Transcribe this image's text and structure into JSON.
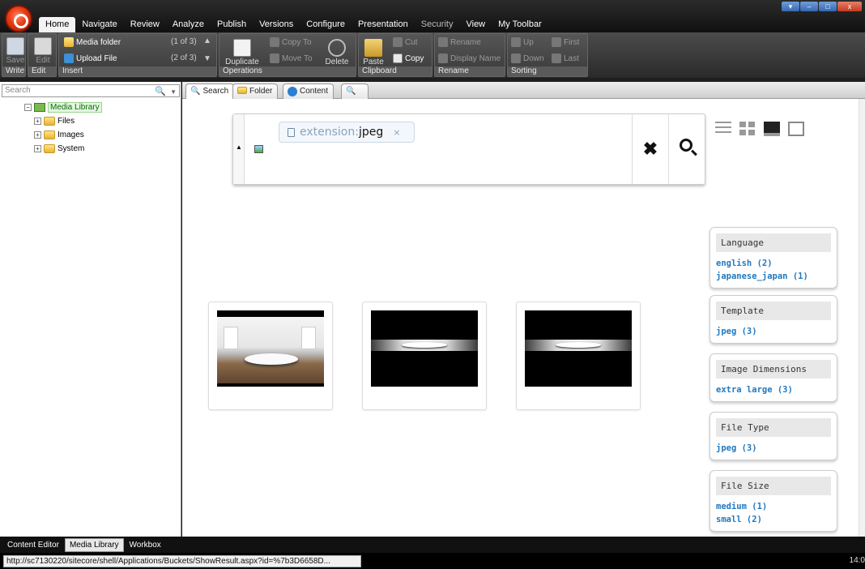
{
  "menu": {
    "items": [
      "Home",
      "Navigate",
      "Review",
      "Analyze",
      "Publish",
      "Versions",
      "Configure",
      "Presentation",
      "Security",
      "View",
      "My Toolbar"
    ]
  },
  "ribbon": {
    "write": {
      "group": "Write",
      "save": "Save"
    },
    "edit": {
      "group": "Edit",
      "edit": "Edit"
    },
    "insert": {
      "group": "Insert",
      "media_folder": "Media folder",
      "upload_file": "Upload File",
      "count1": "(1 of 3)",
      "count2": "(2 of 3)"
    },
    "operations": {
      "group": "Operations",
      "duplicate": "Duplicate",
      "copy_to": "Copy To",
      "move_to": "Move To",
      "delete": "Delete"
    },
    "clipboard": {
      "group": "Clipboard",
      "paste": "Paste",
      "cut": "Cut",
      "copy": "Copy"
    },
    "rename": {
      "group": "Rename",
      "rename": "Rename",
      "display_name": "Display Name"
    },
    "sorting": {
      "group": "Sorting",
      "up": "Up",
      "down": "Down",
      "first": "First",
      "last": "Last"
    }
  },
  "sidebar": {
    "search_placeholder": "Search",
    "tree": {
      "root": "Media Library",
      "children": [
        "Files",
        "Images",
        "System"
      ]
    }
  },
  "tabs": [
    {
      "label": "Search"
    },
    {
      "label": "Folder"
    },
    {
      "label": "Content"
    },
    {
      "label": ""
    }
  ],
  "search": {
    "filter_key": "extension:",
    "filter_value": "jpeg",
    "filter_remove": "×"
  },
  "results": [
    {
      "type": "room"
    },
    {
      "type": "strip"
    },
    {
      "type": "strip"
    }
  ],
  "facets": [
    {
      "title": "Language",
      "links": [
        "english (2)",
        "japanese_japan (1)"
      ]
    },
    {
      "title": "Template",
      "links": [
        "jpeg (3)"
      ]
    },
    {
      "title": "Image Dimensions",
      "links": [
        "extra large (3)"
      ]
    },
    {
      "title": "File Type",
      "links": [
        "jpeg (3)"
      ]
    },
    {
      "title": "File Size",
      "links": [
        "medium (1)",
        "small (2)"
      ]
    }
  ],
  "bottom_tabs": [
    "Content Editor",
    "Media Library",
    "Workbox"
  ],
  "status": {
    "url": "http://sc7130220/sitecore/shell/Applications/Buckets/ShowResult.aspx?id=%7b3D6658D...",
    "clock": "14:0"
  },
  "colors": {
    "link": "#1f78c1",
    "chrome": "#2a2a2a",
    "logo": "#e63a12"
  }
}
